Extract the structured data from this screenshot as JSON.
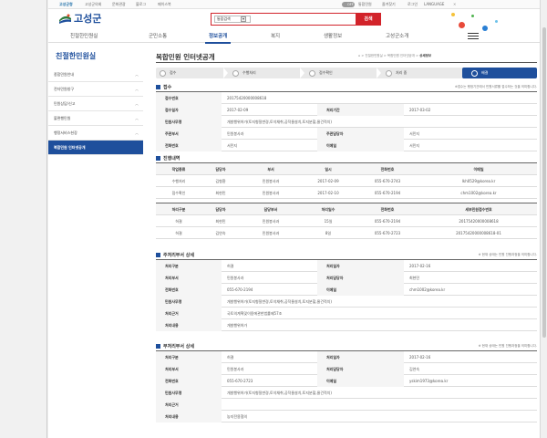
{
  "util_bar": {
    "items": [
      "고성군청",
      "고성군의회",
      "문화관광",
      "블로그",
      "페이스북"
    ],
    "toggle": "OFF",
    "right_items": [
      "통합민원",
      "즐겨찾기",
      "로그인",
      "LANGUAGE"
    ]
  },
  "header": {
    "logo_text": "고성군",
    "search_value": "통합검색",
    "search_button": "검색"
  },
  "gnb": {
    "items": [
      "친절한민원실",
      "군민소통",
      "정보공개",
      "복지",
      "생활정보",
      "고성군소개"
    ],
    "active_index": 2
  },
  "sidebar": {
    "title": "친절한민원실",
    "items": [
      "종합민원안내",
      "전자민원창구",
      "민원상담/신고",
      "불편행민원",
      "행정서비스헌장",
      "복합민원 인터넷공개"
    ],
    "current_index": 5
  },
  "page": {
    "title": "복합민원 인터넷공개",
    "breadcrumb": [
      "친절한민원실",
      "복합민원 인터넷공개",
      "상세정보"
    ]
  },
  "steps": [
    {
      "label": "접수",
      "done": false
    },
    {
      "label": "수행처리",
      "done": false
    },
    {
      "label": "접수확인",
      "done": false
    },
    {
      "label": "처리 중",
      "done": false
    },
    {
      "label": "배결",
      "done": true
    }
  ],
  "receipt": {
    "title": "접수",
    "note": "※접수는 행정기관에서 민원서류를 접수하는 것을 의미합니다.",
    "rows": [
      {
        "k1": "접수번호",
        "v1": "20175420000008618"
      },
      {
        "k1": "접수일자",
        "v1": "2017-02-09",
        "k2": "처리기간",
        "v2": "2017-03-02"
      },
      {
        "k1": "민원사무명",
        "v1": "개발행위허가(토지형질변경,토석채취,공작물설치,토지분할,물건적치)"
      },
      {
        "k1": "주관부서",
        "v1": "민원봉사과",
        "k2": "주관담당자",
        "v2": "서민지"
      },
      {
        "k1": "전화번호",
        "v1": "서민지",
        "k2": "이메일",
        "v2": "서민지"
      }
    ]
  },
  "progress": {
    "title": "진행내역",
    "head1": [
      "작업종류",
      "담당자",
      "부서",
      "일시",
      "전화번호",
      "이메일"
    ],
    "rows1": [
      [
        "수행처리",
        "김형환",
        "민원봉사과",
        "2017-02-09",
        "055-670-2743",
        "lkh0529@korea.kr"
      ],
      [
        "접수확인",
        "최현민",
        "민원봉사과",
        "2017-02-10",
        "055-670-2194",
        "chm1002@korea.kr"
      ]
    ],
    "head2": [
      "처리구분",
      "담당자",
      "담당부서",
      "처리일수",
      "전화번호",
      "세부민원접수번호"
    ],
    "rows2": [
      [
        "허결",
        "최현민",
        "민원봉사과",
        "15일",
        "055-670-2194",
        "20175420000008618"
      ],
      [
        "허결",
        "김연숙",
        "민원봉사과",
        "8일",
        "055-670-2723",
        "20175420000008618-01"
      ]
    ]
  },
  "main_dept": {
    "title": "주처리부서 상세",
    "note": "※ 현재 상태는 민원 진행과정을 의미합니다.",
    "rows": [
      {
        "k1": "처리구분",
        "v1": "허결",
        "k2": "처리일자",
        "v2": "2017-02-16"
      },
      {
        "k1": "처리부서",
        "v1": "민원봉사과",
        "k2": "처리담당자",
        "v2": "최현민"
      },
      {
        "k1": "전화번호",
        "v1": "055-670-2194",
        "k2": "이메일",
        "v2": "chm1002@korea.kr"
      },
      {
        "k1": "민원사무명",
        "v1": "개발행위허가(토지형질변경,토석채취,공작물설치,토지분할,물건적치)"
      },
      {
        "k1": "처리근거",
        "v1": "국토의계획및이용에관한법률제57조"
      },
      {
        "k1": "처리내용",
        "v1": "개발행위허가"
      }
    ]
  },
  "sub_dept": {
    "title": "부처리부서 상세",
    "note": "※ 현재 상태는 민원 진행과정을 의미합니다.",
    "rows": [
      {
        "k1": "처리구분",
        "v1": "허결",
        "k2": "처리일자",
        "v2": "2017-02-16"
      },
      {
        "k1": "처리부서",
        "v1": "민원봉사과",
        "k2": "처리담당자",
        "v2": "김연숙"
      },
      {
        "k1": "전화번호",
        "v1": "055-670-2723",
        "k2": "이메일",
        "v2": "yskim1973@korea.kr"
      },
      {
        "k1": "민원사무명",
        "v1": "개발행위허가(토지형질변경,토석채취,공작물설치,토지분할,물건적치)"
      },
      {
        "k1": "처리근거",
        "v1": ""
      },
      {
        "k1": "처리내용",
        "v1": "농지전용협의"
      }
    ]
  },
  "colors": {
    "brand_blue": "#1e4f9c",
    "search_red": "#d2232a"
  }
}
